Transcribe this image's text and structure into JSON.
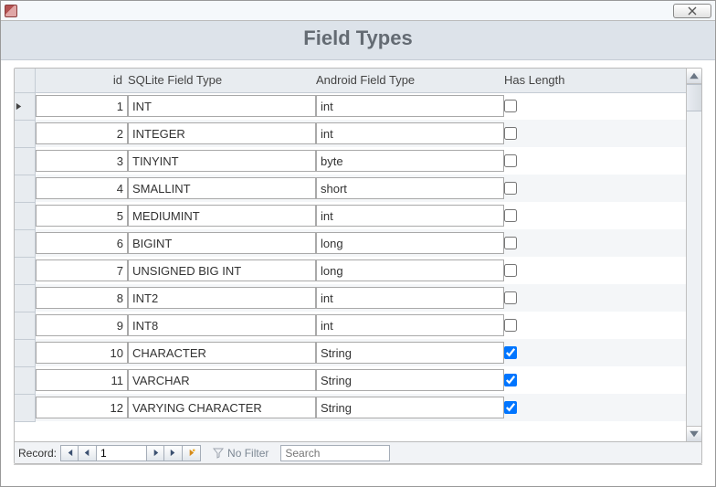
{
  "title": "Field Types",
  "columns": {
    "id": "id",
    "sqlite": "SQLite Field Type",
    "android": "Android Field Type",
    "has": "Has Length"
  },
  "rows": [
    {
      "id": "1",
      "sqlite": "INT",
      "android": "int",
      "has": false,
      "current": true
    },
    {
      "id": "2",
      "sqlite": "INTEGER",
      "android": "int",
      "has": false
    },
    {
      "id": "3",
      "sqlite": "TINYINT",
      "android": "byte",
      "has": false
    },
    {
      "id": "4",
      "sqlite": "SMALLINT",
      "android": "short",
      "has": false
    },
    {
      "id": "5",
      "sqlite": "MEDIUMINT",
      "android": "int",
      "has": false
    },
    {
      "id": "6",
      "sqlite": "BIGINT",
      "android": "long",
      "has": false
    },
    {
      "id": "7",
      "sqlite": "UNSIGNED BIG INT",
      "android": "long",
      "has": false
    },
    {
      "id": "8",
      "sqlite": "INT2",
      "android": "int",
      "has": false
    },
    {
      "id": "9",
      "sqlite": "INT8",
      "android": "int",
      "has": false
    },
    {
      "id": "10",
      "sqlite": "CHARACTER",
      "android": "String",
      "has": true
    },
    {
      "id": "11",
      "sqlite": "VARCHAR",
      "android": "String",
      "has": true
    },
    {
      "id": "12",
      "sqlite": "VARYING CHARACTER",
      "android": "String",
      "has": true
    }
  ],
  "nav": {
    "label": "Record:",
    "current": "1",
    "nofilter": "No Filter",
    "search_ph": "Search"
  }
}
